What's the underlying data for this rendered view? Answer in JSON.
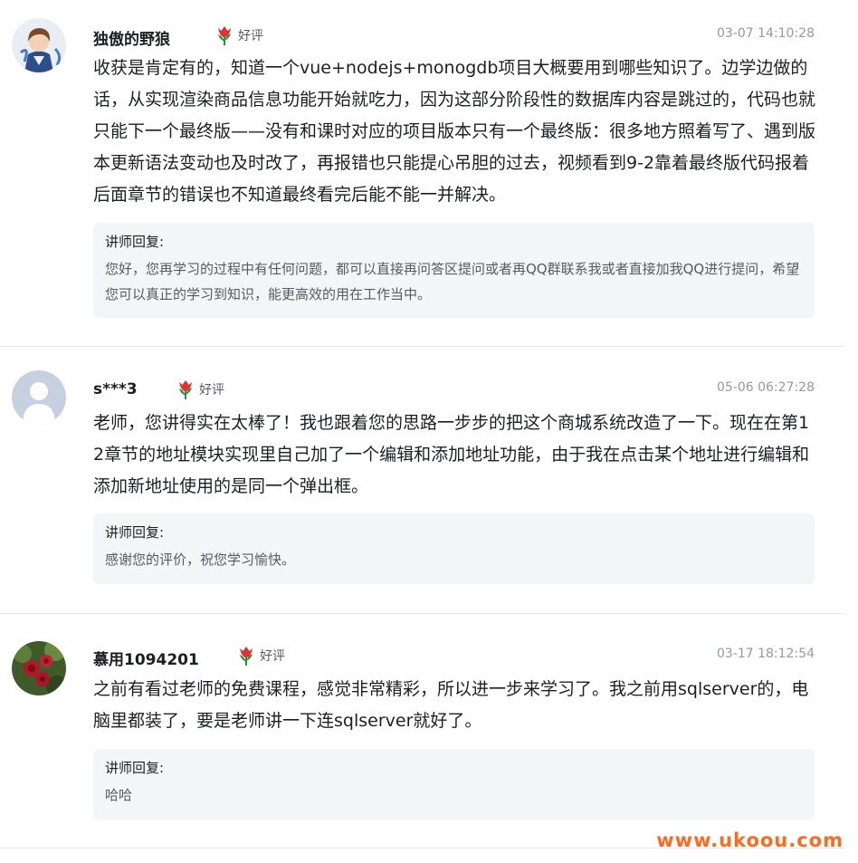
{
  "reviews": [
    {
      "username": "独傲的野狼",
      "rating": "好评",
      "time": "03-07 14:10:28",
      "content": "收获是肯定有的，知道一个vue+nodejs+monogdb项目大概要用到哪些知识了。边学边做的话，从实现渲染商品信息功能开始就吃力，因为这部分阶段性的数据库内容是跳过的，代码也就只能下一个最终版——没有和课时对应的项目版本只有一个最终版：很多地方照着写了、遇到版本更新语法变动也及时改了，再报错也只能提心吊胆的过去，视频看到9-2靠着最终版代码报着后面章节的错误也不知道最终看完后能不能一并解决。",
      "reply_title": "讲师回复:",
      "reply_text": "您好，您再学习的过程中有任何问题，都可以直接再问答区提问或者再QQ群联系我或者直接加我QQ进行提问，希望您可以真正的学习到知识，能更高效的用在工作当中。"
    },
    {
      "username": "s***3",
      "rating": "好评",
      "time": "05-06 06:27:28",
      "content": "老师，您讲得实在太棒了！我也跟着您的思路一步步的把这个商城系统改造了一下。现在在第12章节的地址模块实现里自己加了一个编辑和添加地址功能，由于我在点击某个地址进行编辑和添加新地址使用的是同一个弹出框。",
      "reply_title": "讲师回复:",
      "reply_text": "感谢您的评价，祝您学习愉快。"
    },
    {
      "username": "慕用1094201",
      "rating": "好评",
      "time": "03-17 18:12:54",
      "content": "之前有看过老师的免费课程，感觉非常精彩，所以进一步来学习了。我之前用sqlserver的，电脑里都装了，要是老师讲一下连sqlserver就好了。",
      "reply_title": "讲师回复:",
      "reply_text": "哈哈"
    }
  ],
  "watermark": "www.ukoou.com",
  "colors": {
    "rating_flower": "#e0322f",
    "leaf": "#2f8f3a",
    "watermark": "#ff6a1f"
  },
  "icons": {
    "rating": "flower-icon",
    "default_avatar": "user-silhouette-icon"
  }
}
